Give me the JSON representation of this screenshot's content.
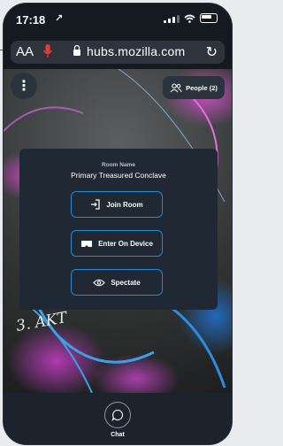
{
  "status": {
    "time": "17:18",
    "arrow": "↗"
  },
  "browser": {
    "text_size_label": "AA",
    "host": "hubs.mozilla.com"
  },
  "toolbar": {
    "people_label": "People (2)"
  },
  "room": {
    "label": "Room Name",
    "name": "Primary Treasured Conclave",
    "join_label": "Join Room",
    "enter_device_label": "Enter On Device",
    "spectate_label": "Spectate"
  },
  "scene": {
    "graffiti": "3. AKT"
  },
  "chat": {
    "label": "Chat"
  },
  "colors": {
    "accent": "#1f8ad6",
    "panel": "#1f2833",
    "record": "#e23c3c"
  }
}
